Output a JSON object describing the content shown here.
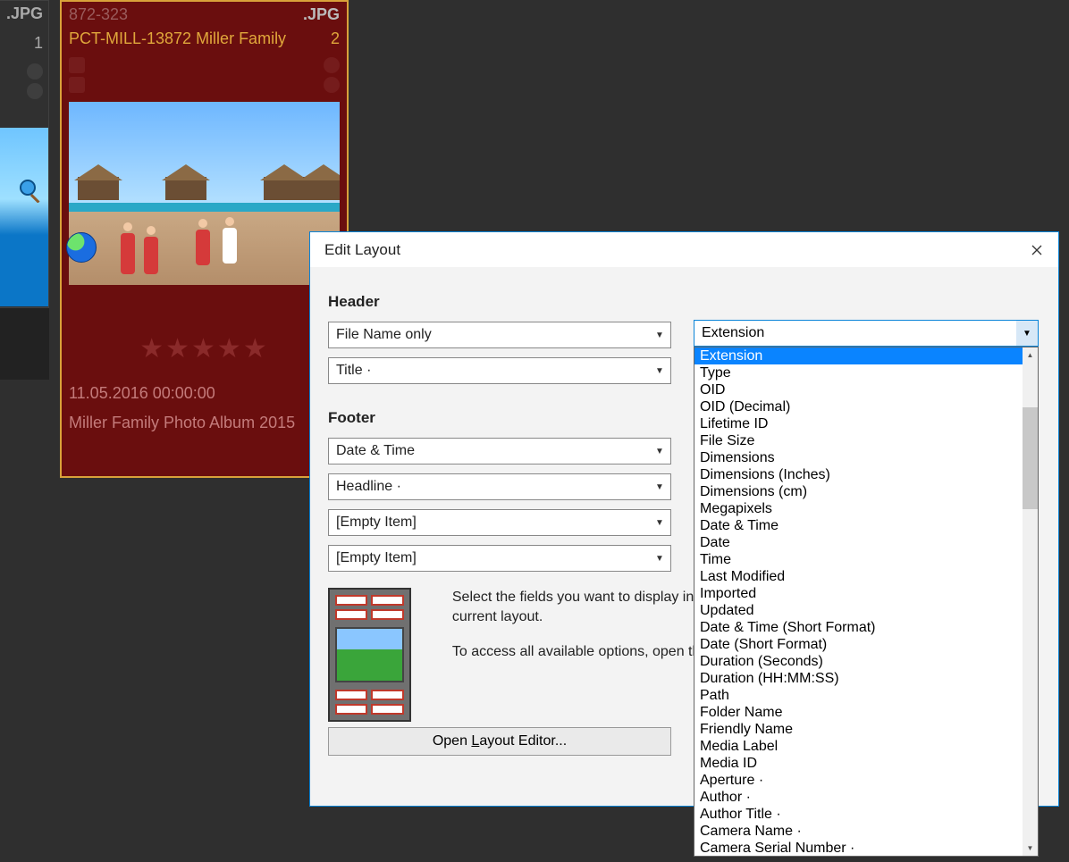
{
  "thumb_partial": {
    "ext": ".JPG",
    "num": "1"
  },
  "thumb_selected": {
    "code": "872-323",
    "ext": ".JPG",
    "name": "PCT-MILL-13872 Miller Family",
    "num": "2",
    "stars": "★★★★★",
    "date": "11.05.2016 00:00:00",
    "album": "Miller Family Photo Album 2015"
  },
  "dialog": {
    "title": "Edit Layout",
    "sections": {
      "header": "Header",
      "footer": "Footer"
    },
    "combos": {
      "h1": "File Name only",
      "h2": "Title ·",
      "f1": "Date & Time",
      "f2": "Headline ·",
      "f3": "[Empty Item]",
      "f4": "[Empty Item]"
    },
    "right_combo": "Extension",
    "info1": "Select the fields you want to display in the thumbnail panels. Your changes are saved to the current layout.",
    "info2": "To access all available options, open the layout editor button below.",
    "open_button_pre": "Open ",
    "open_button_u": "L",
    "open_button_post": "ayout Editor..."
  },
  "dropdown": {
    "selected": "Extension",
    "items": [
      "Extension",
      "Type",
      "OID",
      "OID (Decimal)",
      "Lifetime ID",
      "File Size",
      "Dimensions",
      "Dimensions (Inches)",
      "Dimensions (cm)",
      "Megapixels",
      "Date & Time",
      "Date",
      "Time",
      "Last Modified",
      "Imported",
      "Updated",
      "Date & Time (Short Format)",
      "Date (Short Format)",
      "Duration (Seconds)",
      "Duration (HH:MM:SS)",
      "Path",
      "Folder Name",
      "Friendly Name",
      "Media Label",
      "Media ID",
      "Aperture ·",
      "Author ·",
      "Author Title ·",
      "Camera Name ·",
      "Camera Serial Number ·"
    ]
  }
}
